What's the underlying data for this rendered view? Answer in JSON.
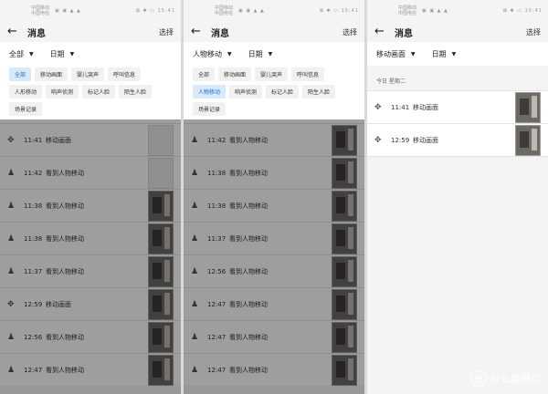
{
  "status": {
    "carrier_top": "中国移动",
    "carrier_bottom": "中国电信",
    "icons": "▣ ▣ ▲ ▲",
    "right": "⊠ ✱ ▭ 15:41"
  },
  "panels": [
    {
      "back_icon": "arrow-left-icon",
      "title": "消息",
      "select_label": "选择",
      "filter_type": "全部",
      "filter_date": "日期",
      "chips": [
        "全部",
        "移动画面",
        "婴儿哭声",
        "呼叫信息",
        "人形移动",
        "响声侦测",
        "标记人脸",
        "陌生人脸",
        "场景记录"
      ],
      "selected_chip": 0,
      "rows": [
        {
          "icon": "move-icon",
          "time": "11:41",
          "text": "移动画面",
          "thumb": "blank"
        },
        {
          "icon": "person-icon",
          "time": "11:42",
          "text": "看到人物移动",
          "thumb": "blank"
        },
        {
          "icon": "person-icon",
          "time": "11:38",
          "text": "看到人物移动",
          "thumb": "photo"
        },
        {
          "icon": "person-icon",
          "time": "11:38",
          "text": "看到人物移动",
          "thumb": "photo"
        },
        {
          "icon": "person-icon",
          "time": "11:37",
          "text": "看到人物移动",
          "thumb": "photo"
        },
        {
          "icon": "move-icon",
          "time": "12:59",
          "text": "移动画面",
          "thumb": "photo"
        },
        {
          "icon": "person-icon",
          "time": "12:56",
          "text": "看到人物移动",
          "thumb": "photo"
        },
        {
          "icon": "person-icon",
          "time": "12:47",
          "text": "看到人物移动",
          "thumb": "photo"
        }
      ]
    },
    {
      "back_icon": "arrow-left-icon",
      "title": "消息",
      "select_label": "选择",
      "filter_type": "人物移动",
      "filter_date": "日期",
      "chips": [
        "全部",
        "移动画面",
        "婴儿哭声",
        "呼叫信息",
        "人物移动",
        "响声侦测",
        "标记人脸",
        "陌生人脸",
        "场景记录"
      ],
      "selected_chip": 4,
      "rows": [
        {
          "icon": "person-icon",
          "time": "11:42",
          "text": "看到人物移动",
          "thumb": "photo"
        },
        {
          "icon": "person-icon",
          "time": "11:38",
          "text": "看到人物移动",
          "thumb": "photo"
        },
        {
          "icon": "person-icon",
          "time": "11:38",
          "text": "看到人物移动",
          "thumb": "photo"
        },
        {
          "icon": "person-icon",
          "time": "11:37",
          "text": "看到人物移动",
          "thumb": "photo"
        },
        {
          "icon": "person-icon",
          "time": "12:56",
          "text": "看到人物移动",
          "thumb": "photo"
        },
        {
          "icon": "person-icon",
          "time": "12:47",
          "text": "看到人物移动",
          "thumb": "photo"
        },
        {
          "icon": "person-icon",
          "time": "12:47",
          "text": "看到人物移动",
          "thumb": "photo"
        },
        {
          "icon": "person-icon",
          "time": "12:47",
          "text": "看到人物移动",
          "thumb": "photo"
        }
      ]
    },
    {
      "back_icon": "arrow-left-icon",
      "title": "消息",
      "select_label": "选择",
      "filter_type": "移动画面",
      "filter_date": "日期",
      "day_header": "今日 星期二",
      "rows": [
        {
          "icon": "move-icon",
          "time": "11:41",
          "text": "移动画面",
          "thumb": "photo"
        },
        {
          "icon": "move-icon",
          "time": "12:59",
          "text": "移动画面",
          "thumb": "photo"
        }
      ]
    }
  ],
  "watermark": {
    "glyph": "值",
    "text": "什么值得买"
  }
}
